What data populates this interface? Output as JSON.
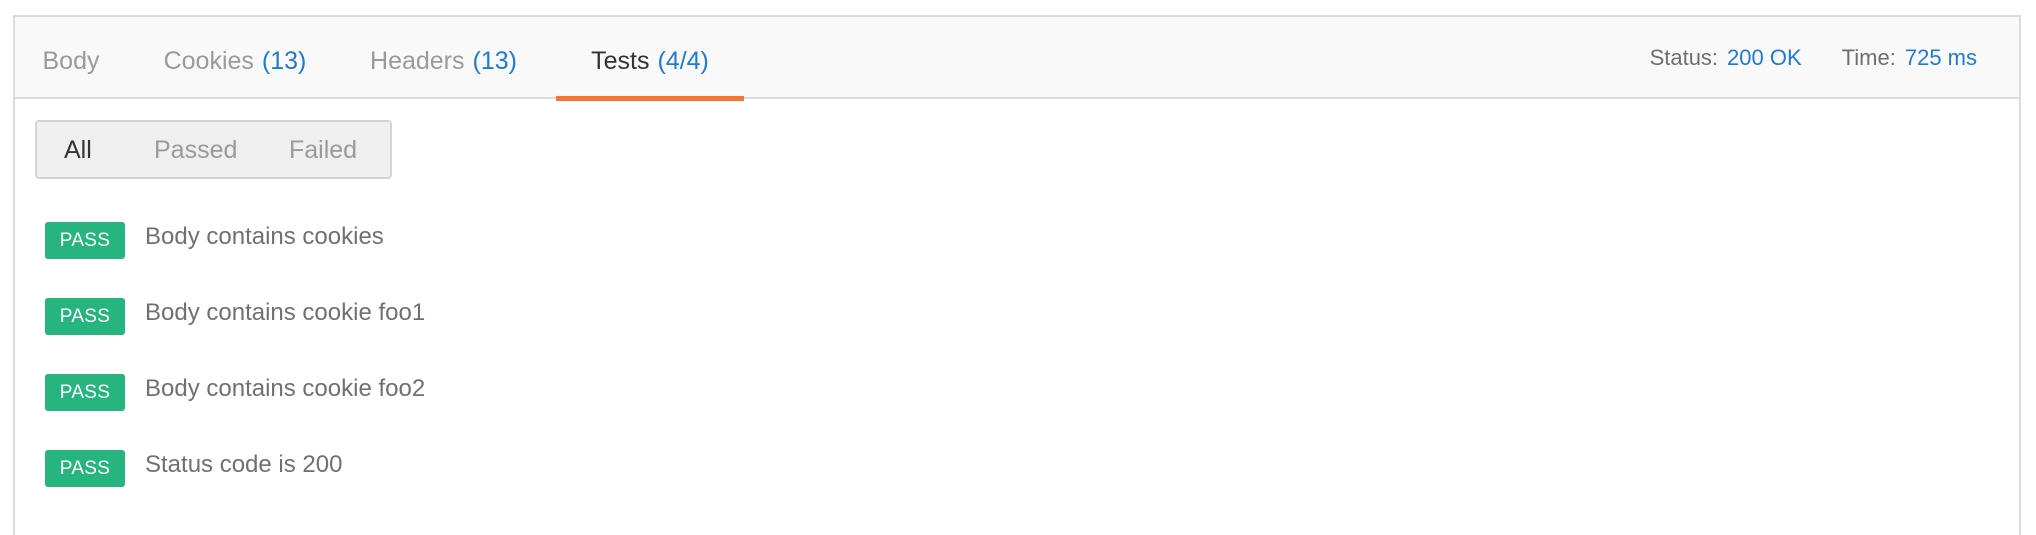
{
  "tabs": [
    {
      "label": "Body",
      "count": ""
    },
    {
      "label": "Cookies",
      "count": "(13)"
    },
    {
      "label": "Headers",
      "count": "(13)"
    },
    {
      "label": "Tests",
      "count": "(4/4)"
    }
  ],
  "active_tab": "Tests",
  "status": {
    "status_label": "Status:",
    "status_value": "200 OK",
    "time_label": "Time:",
    "time_value": "725 ms"
  },
  "filter": {
    "options": [
      "All",
      "Passed",
      "Failed"
    ],
    "selected": "All"
  },
  "tests": [
    {
      "result": "PASS",
      "name": "Body contains cookies"
    },
    {
      "result": "PASS",
      "name": "Body contains cookie foo1"
    },
    {
      "result": "PASS",
      "name": "Body contains cookie foo2"
    },
    {
      "result": "PASS",
      "name": "Status code is 200"
    }
  ],
  "colors": {
    "accent_tab": "#f37737",
    "link_blue": "#1f7ad7",
    "pass_green": "#26b47f"
  }
}
